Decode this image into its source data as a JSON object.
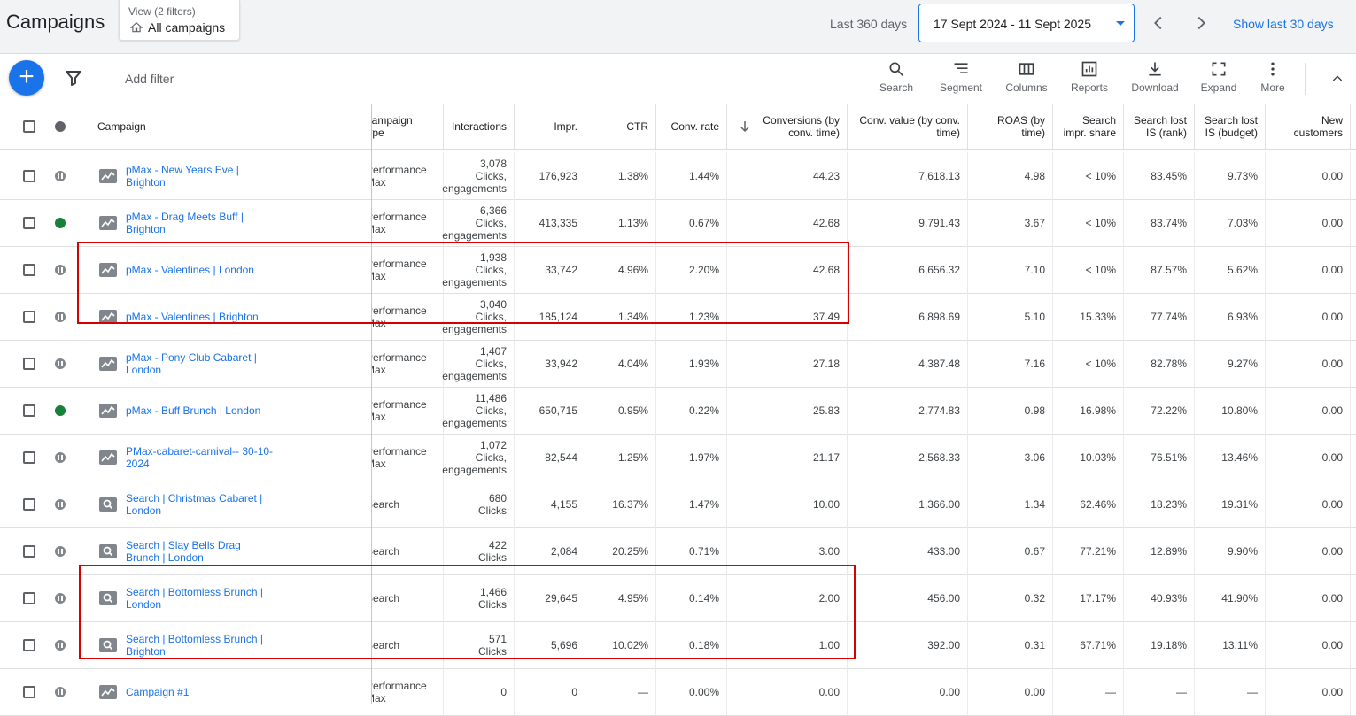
{
  "header": {
    "title": "Campaigns",
    "view_sub": "View (2 filters)",
    "view_main": "All campaigns",
    "range_label": "Last 360 days",
    "date_range": "17 Sept 2024 - 11 Sept 2025",
    "show_last": "Show last 30 days"
  },
  "toolbar": {
    "add_filter": "Add filter",
    "tools": [
      {
        "label": "Search",
        "icon": "search-icon"
      },
      {
        "label": "Segment",
        "icon": "segment-icon"
      },
      {
        "label": "Columns",
        "icon": "columns-icon"
      },
      {
        "label": "Reports",
        "icon": "reports-icon"
      },
      {
        "label": "Download",
        "icon": "download-icon"
      },
      {
        "label": "Expand",
        "icon": "expand-icon"
      },
      {
        "label": "More",
        "icon": "more-vert-icon"
      }
    ]
  },
  "columns": {
    "campaign": "Campaign",
    "campaign_type": "Campaign\ntype",
    "interactions": "Interactions",
    "impr": "Impr.",
    "ctr": "CTR",
    "conv_rate": "Conv. rate",
    "conversions": "Conversions (by\nconv. time)",
    "conv_value": "Conv. value (by conv.\ntime)",
    "roas": "ROAS (by\ntime)",
    "search_impr_share": "Search\nimpr. share",
    "search_lost_rank": "Search lost\nIS (rank)",
    "search_lost_budget": "Search lost\nIS (budget)",
    "new_customers": "New\ncustomers"
  },
  "rows": [
    {
      "name": "pMax - New Years Eve |\nBrighton",
      "status": "paused",
      "kind": "pmax",
      "type": "Performance\nMax",
      "interactions": "3,078\nClicks,\nengagements",
      "impr": "176,923",
      "ctr": "1.38%",
      "conv_rate": "1.44%",
      "conversions": "44.23",
      "conv_value": "7,618.13",
      "roas": "4.98",
      "sis": "< 10%",
      "rank": "83.45%",
      "budget": "9.73%",
      "newc": "0.00"
    },
    {
      "name": "pMax - Drag Meets Buff |\nBrighton",
      "status": "enabled",
      "kind": "pmax",
      "type": "Performance\nMax",
      "interactions": "6,366\nClicks,\nengagements",
      "impr": "413,335",
      "ctr": "1.13%",
      "conv_rate": "0.67%",
      "conversions": "42.68",
      "conv_value": "9,791.43",
      "roas": "3.67",
      "sis": "< 10%",
      "rank": "83.74%",
      "budget": "7.03%",
      "newc": "0.00"
    },
    {
      "name": "pMax - Valentines | London",
      "status": "paused",
      "kind": "pmax",
      "type": "Performance\nMax",
      "interactions": "1,938\nClicks,\nengagements",
      "impr": "33,742",
      "ctr": "4.96%",
      "conv_rate": "2.20%",
      "conversions": "42.68",
      "conv_value": "6,656.32",
      "roas": "7.10",
      "sis": "< 10%",
      "rank": "87.57%",
      "budget": "5.62%",
      "newc": "0.00"
    },
    {
      "name": "pMax - Valentines | Brighton",
      "status": "paused",
      "kind": "pmax",
      "type": "Performance\nMax",
      "interactions": "3,040\nClicks,\nengagements",
      "impr": "185,124",
      "ctr": "1.34%",
      "conv_rate": "1.23%",
      "conversions": "37.49",
      "conv_value": "6,898.69",
      "roas": "5.10",
      "sis": "15.33%",
      "rank": "77.74%",
      "budget": "6.93%",
      "newc": "0.00"
    },
    {
      "name": "pMax - Pony Club Cabaret |\nLondon",
      "status": "paused",
      "kind": "pmax",
      "type": "Performance\nMax",
      "interactions": "1,407\nClicks,\nengagements",
      "impr": "33,942",
      "ctr": "4.04%",
      "conv_rate": "1.93%",
      "conversions": "27.18",
      "conv_value": "4,387.48",
      "roas": "7.16",
      "sis": "< 10%",
      "rank": "82.78%",
      "budget": "9.27%",
      "newc": "0.00"
    },
    {
      "name": "pMax - Buff Brunch | London",
      "status": "enabled",
      "kind": "pmax",
      "type": "Performance\nMax",
      "interactions": "11,486\nClicks,\nengagements",
      "impr": "650,715",
      "ctr": "0.95%",
      "conv_rate": "0.22%",
      "conversions": "25.83",
      "conv_value": "2,774.83",
      "roas": "0.98",
      "sis": "16.98%",
      "rank": "72.22%",
      "budget": "10.80%",
      "newc": "0.00"
    },
    {
      "name": "PMax-cabaret-carnival-- 30-10-\n2024",
      "status": "paused",
      "kind": "pmax",
      "type": "Performance\nMax",
      "interactions": "1,072\nClicks,\nengagements",
      "impr": "82,544",
      "ctr": "1.25%",
      "conv_rate": "1.97%",
      "conversions": "21.17",
      "conv_value": "2,568.33",
      "roas": "3.06",
      "sis": "10.03%",
      "rank": "76.51%",
      "budget": "13.46%",
      "newc": "0.00"
    },
    {
      "name": "Search | Christmas Cabaret |\nLondon",
      "status": "paused",
      "kind": "search",
      "type": "Search",
      "interactions": "680\nClicks",
      "impr": "4,155",
      "ctr": "16.37%",
      "conv_rate": "1.47%",
      "conversions": "10.00",
      "conv_value": "1,366.00",
      "roas": "1.34",
      "sis": "62.46%",
      "rank": "18.23%",
      "budget": "19.31%",
      "newc": "0.00"
    },
    {
      "name": "Search | Slay Bells Drag\nBrunch | London",
      "status": "paused",
      "kind": "search",
      "type": "Search",
      "interactions": "422\nClicks",
      "impr": "2,084",
      "ctr": "20.25%",
      "conv_rate": "0.71%",
      "conversions": "3.00",
      "conv_value": "433.00",
      "roas": "0.67",
      "sis": "77.21%",
      "rank": "12.89%",
      "budget": "9.90%",
      "newc": "0.00"
    },
    {
      "name": "Search | Bottomless Brunch |\nLondon",
      "status": "paused",
      "kind": "search",
      "type": "Search",
      "interactions": "1,466\nClicks",
      "impr": "29,645",
      "ctr": "4.95%",
      "conv_rate": "0.14%",
      "conversions": "2.00",
      "conv_value": "456.00",
      "roas": "0.32",
      "sis": "17.17%",
      "rank": "40.93%",
      "budget": "41.90%",
      "newc": "0.00"
    },
    {
      "name": "Search | Bottomless Brunch |\nBrighton",
      "status": "paused",
      "kind": "search",
      "type": "Search",
      "interactions": "571\nClicks",
      "impr": "5,696",
      "ctr": "10.02%",
      "conv_rate": "0.18%",
      "conversions": "1.00",
      "conv_value": "392.00",
      "roas": "0.31",
      "sis": "67.71%",
      "rank": "19.18%",
      "budget": "13.11%",
      "newc": "0.00"
    },
    {
      "name": "Campaign #1",
      "status": "paused",
      "kind": "pmax",
      "type": "Performance\nMax",
      "interactions": "0",
      "impr": "0",
      "ctr": "—",
      "conv_rate": "0.00%",
      "conversions": "0.00",
      "conv_value": "0.00",
      "roas": "0.00",
      "sis": "—",
      "rank": "—",
      "budget": "—",
      "newc": "0.00"
    }
  ],
  "colors": {
    "accent": "#1a73e8",
    "enabled": "#188038",
    "paused": "#80868b",
    "highlight": "#d50000"
  }
}
